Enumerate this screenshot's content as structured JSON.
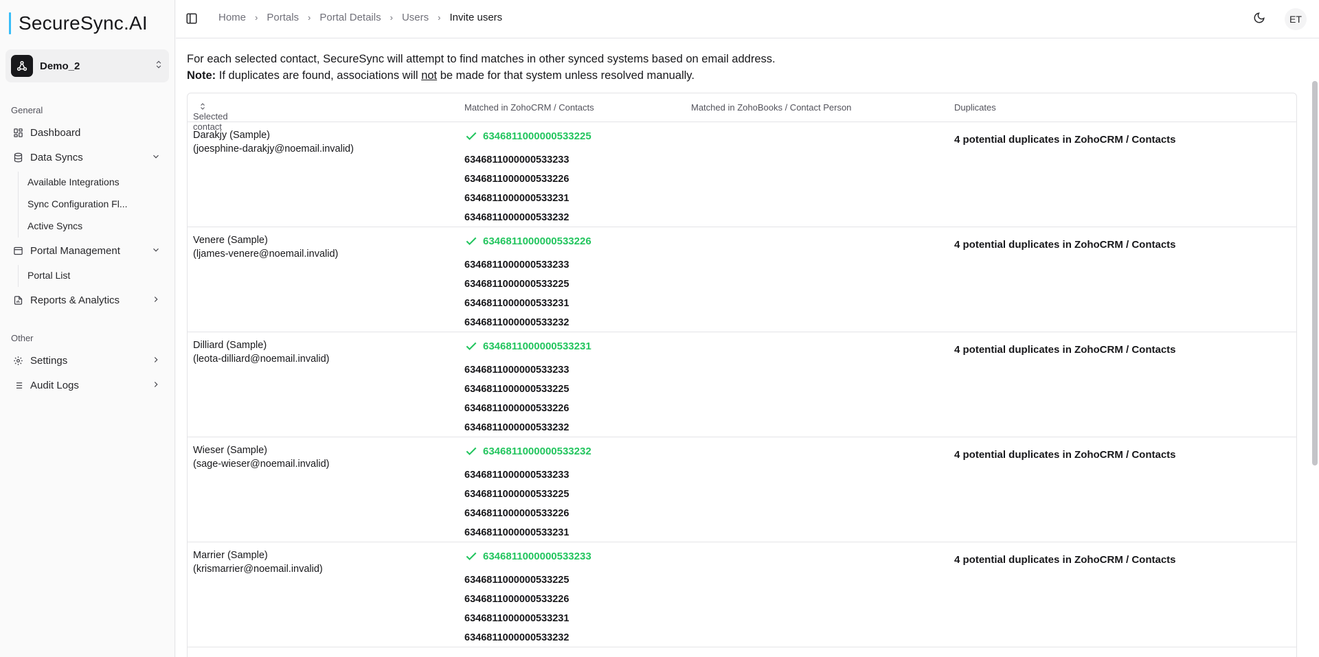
{
  "brand": {
    "name": "SecureSync.AI"
  },
  "workspace": {
    "name": "Demo_2"
  },
  "sidebar": {
    "general_label": "General",
    "other_label": "Other",
    "dashboard": "Dashboard",
    "data_syncs": "Data Syncs",
    "data_syncs_children": [
      "Available Integrations",
      "Sync Configuration Fl...",
      "Active Syncs"
    ],
    "portal_management": "Portal Management",
    "portal_children": [
      "Portal List"
    ],
    "reports": "Reports & Analytics",
    "settings": "Settings",
    "audit_logs": "Audit Logs"
  },
  "breadcrumb": [
    "Home",
    "Portals",
    "Portal Details",
    "Users",
    "Invite users"
  ],
  "user": {
    "initials": "ET"
  },
  "description": {
    "line1": "For each selected contact, SecureSync will attempt to find matches in other synced systems based on email address.",
    "note_label": "Note:",
    "note_pre": "If duplicates are found, associations will",
    "note_not": "not",
    "note_post": "be made for that system unless resolved manually."
  },
  "table": {
    "headers": {
      "contact": "Selected contact",
      "zohocrm": "Matched in ZohoCRM / Contacts",
      "zohobooks": "Matched in ZohoBooks / Contact Person",
      "duplicates": "Duplicates"
    },
    "rows": [
      {
        "name": "Darakjy (Sample)",
        "email": "(joesphine-darakjy@noemail.invalid)",
        "match": "6346811000000533225",
        "others": [
          "6346811000000533233",
          "6346811000000533226",
          "6346811000000533231",
          "6346811000000533232"
        ],
        "duplicates": "4 potential duplicates in ZohoCRM / Contacts"
      },
      {
        "name": "Venere (Sample)",
        "email": "(ljames-venere@noemail.invalid)",
        "match": "6346811000000533226",
        "others": [
          "6346811000000533233",
          "6346811000000533225",
          "6346811000000533231",
          "6346811000000533232"
        ],
        "duplicates": "4 potential duplicates in ZohoCRM / Contacts"
      },
      {
        "name": "Dilliard (Sample)",
        "email": "(leota-dilliard@noemail.invalid)",
        "match": "6346811000000533231",
        "others": [
          "6346811000000533233",
          "6346811000000533225",
          "6346811000000533226",
          "6346811000000533232"
        ],
        "duplicates": "4 potential duplicates in ZohoCRM / Contacts"
      },
      {
        "name": "Wieser (Sample)",
        "email": "(sage-wieser@noemail.invalid)",
        "match": "6346811000000533232",
        "others": [
          "6346811000000533233",
          "6346811000000533225",
          "6346811000000533226",
          "6346811000000533231"
        ],
        "duplicates": "4 potential duplicates in ZohoCRM / Contacts"
      },
      {
        "name": "Marrier (Sample)",
        "email": "(krismarrier@noemail.invalid)",
        "match": "6346811000000533233",
        "others": [
          "6346811000000533225",
          "6346811000000533226",
          "6346811000000533231",
          "6346811000000533232"
        ],
        "duplicates": "4 potential duplicates in ZohoCRM / Contacts"
      }
    ]
  },
  "colors": {
    "match": "#22c55e",
    "accent": "#38bdf8",
    "text": "#18181b",
    "border": "#e4e4e7"
  },
  "icons": [
    "sidebar-toggle-icon",
    "chevron-right-icon",
    "moon-icon",
    "dashboard-icon",
    "database-icon",
    "portal-icon",
    "reports-icon",
    "settings-icon",
    "audit-icon",
    "check-icon",
    "sort-icon"
  ]
}
